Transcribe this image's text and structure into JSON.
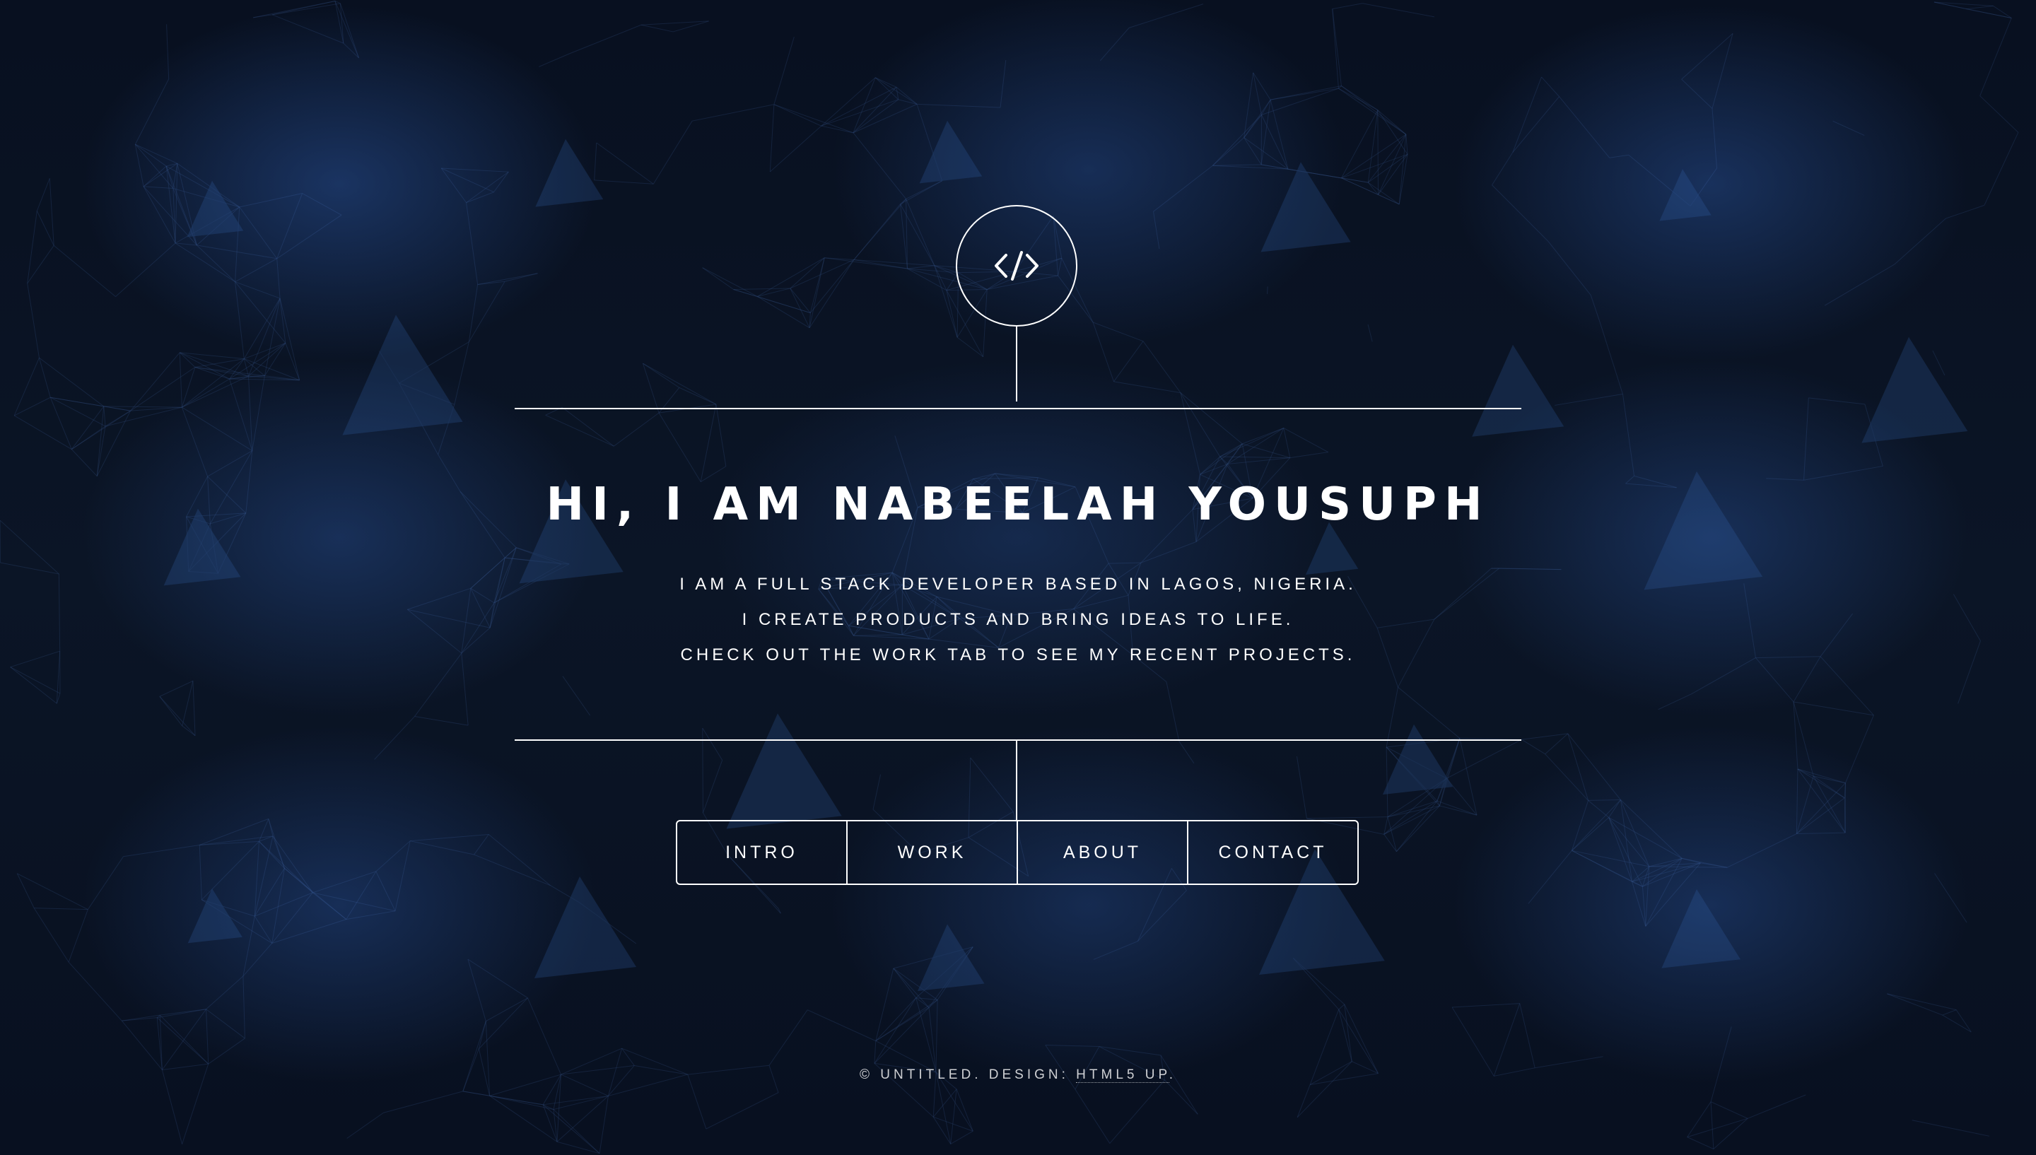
{
  "theme": {
    "background": "#0a0f18",
    "accent": "#2a5aa0",
    "text": "#ffffff"
  },
  "logo": {
    "icon": "code-icon"
  },
  "intro": {
    "headline": "HI, I AM NABEELAH YOUSUPH",
    "lines": [
      "I AM A FULL STACK DEVELOPER BASED IN LAGOS, NIGERIA.",
      "I CREATE PRODUCTS AND BRING IDEAS TO LIFE.",
      "CHECK OUT THE WORK TAB TO SEE MY RECENT PROJECTS."
    ]
  },
  "nav": {
    "items": [
      {
        "label": "INTRO"
      },
      {
        "label": "WORK"
      },
      {
        "label": "ABOUT"
      },
      {
        "label": "CONTACT"
      }
    ]
  },
  "footer": {
    "text": "© UNTITLED. DESIGN: ",
    "link_label": "HTML5 UP",
    "suffix": "."
  }
}
